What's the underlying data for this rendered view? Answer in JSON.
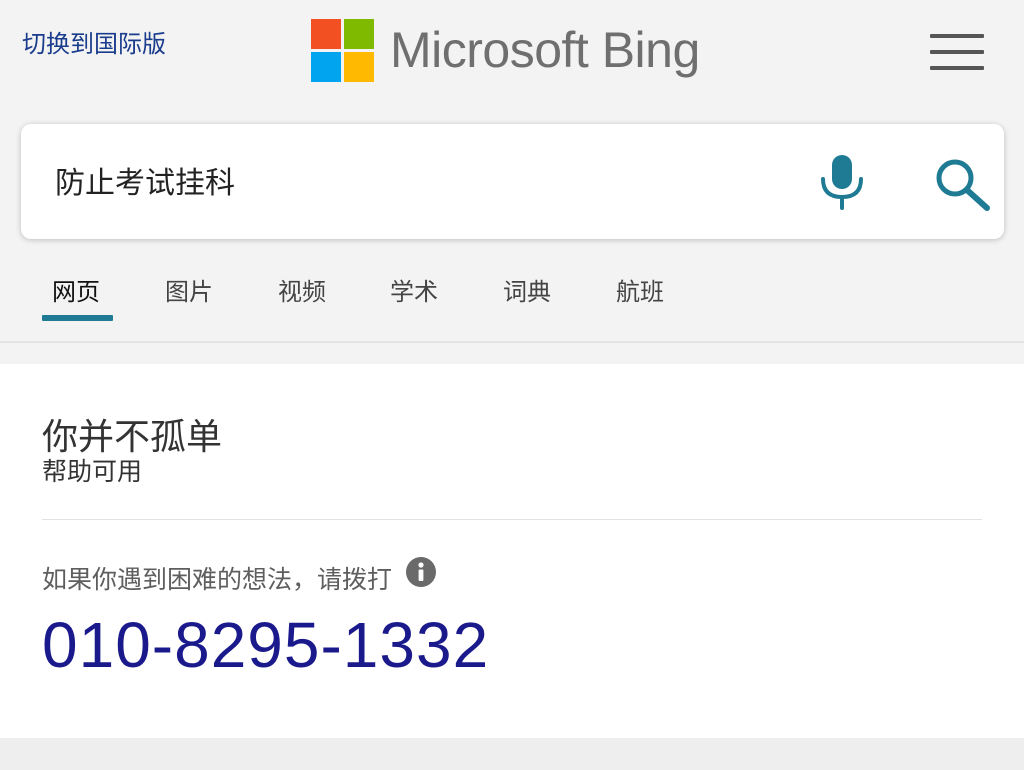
{
  "header": {
    "switch_link": "切换到国际版",
    "logo_text": "Microsoft Bing",
    "logo_colors": [
      "#f25022",
      "#7fba00",
      "#00a4ef",
      "#ffb900"
    ]
  },
  "search": {
    "query": "防止考试挂科"
  },
  "tabs": [
    {
      "label": "网页",
      "active": true
    },
    {
      "label": "图片",
      "active": false
    },
    {
      "label": "视频",
      "active": false
    },
    {
      "label": "学术",
      "active": false
    },
    {
      "label": "词典",
      "active": false
    },
    {
      "label": "航班",
      "active": false
    }
  ],
  "card": {
    "title": "你并不孤单",
    "subtitle": "帮助可用",
    "prompt": "如果你遇到困难的想法，请拨打",
    "phone": "010-8295-1332"
  },
  "colors": {
    "accent": "#1f7a93",
    "phone": "#1a1a8c",
    "link": "#1a3c8c"
  }
}
